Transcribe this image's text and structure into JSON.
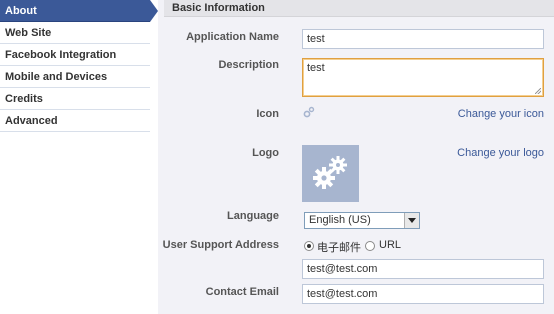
{
  "sidebar": {
    "items": [
      {
        "label": "About",
        "active": true
      },
      {
        "label": "Web Site"
      },
      {
        "label": "Facebook Integration"
      },
      {
        "label": "Mobile and Devices"
      },
      {
        "label": "Credits"
      },
      {
        "label": "Advanced"
      }
    ]
  },
  "section": {
    "title": "Basic Information"
  },
  "form": {
    "app_name": {
      "label": "Application Name",
      "value": "test"
    },
    "description": {
      "label": "Description",
      "value": "test"
    },
    "icon": {
      "label": "Icon",
      "link": "Change your icon"
    },
    "logo": {
      "label": "Logo",
      "link": "Change your logo"
    },
    "language": {
      "label": "Language",
      "value": "English (US)"
    },
    "support": {
      "label": "User Support Address",
      "option_email": "电子邮件",
      "option_url": "URL",
      "selected": "email",
      "value": "test@test.com"
    },
    "contact_email": {
      "label": "Contact Email",
      "value": "test@test.com"
    }
  },
  "colors": {
    "accent": "#3b5998",
    "logo_bg": "#a7b5cf",
    "focus": "#e0a040"
  }
}
